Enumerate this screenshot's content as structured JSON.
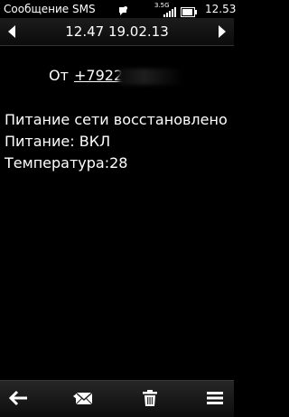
{
  "status_bar": {
    "title": "Сообщение SMS",
    "network": "3.5G",
    "time": "12.53",
    "icons": [
      "notification-icon",
      "signal-icon",
      "battery-icon"
    ]
  },
  "header": {
    "datetime": "12.47 19.02.13",
    "icons": [
      "previous-arrow-icon",
      "next-arrow-icon"
    ]
  },
  "sender": {
    "label": "От",
    "number": "+7922"
  },
  "message": {
    "lines": [
      "Питание сети восстановлено",
      "Питание: ВКЛ",
      "Температура:28"
    ]
  },
  "toolbar": {
    "icons": [
      "back-arrow-icon",
      "reply-envelope-icon",
      "delete-trash-icon",
      "options-menu-icon"
    ]
  },
  "colors": {
    "background": "#000000",
    "text": "#ffffff",
    "header_gradient_top": "#1c1c1c",
    "toolbar_gradient_top": "#262626"
  }
}
